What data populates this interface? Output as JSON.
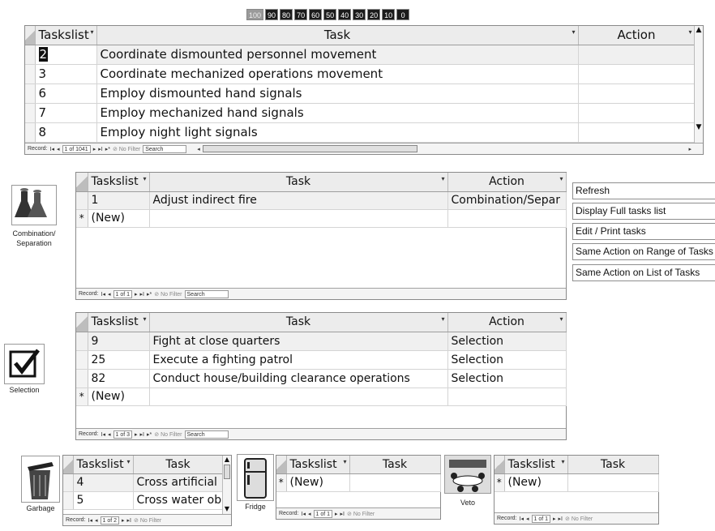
{
  "percent_buttons": [
    "100",
    "90",
    "80",
    "70",
    "60",
    "50",
    "40",
    "30",
    "20",
    "10",
    "0"
  ],
  "active_percent": "100",
  "columns": {
    "tasklist": "Taskslist",
    "task": "Task",
    "action": "Action"
  },
  "main_grid": {
    "rows": [
      {
        "id": "2",
        "task": "Coordinate dismounted personnel movement",
        "action": ""
      },
      {
        "id": "3",
        "task": "Coordinate mechanized operations movement",
        "action": ""
      },
      {
        "id": "6",
        "task": "Employ dismounted hand signals",
        "action": ""
      },
      {
        "id": "7",
        "task": "Employ mechanized hand signals",
        "action": ""
      },
      {
        "id": "8",
        "task": "Employ night light signals",
        "action": ""
      }
    ],
    "record": "Record:",
    "record_pos": "1 of 1041",
    "no_filter": "No Filter",
    "search": "Search"
  },
  "combination": {
    "label": "Combination/ Separation",
    "rows": [
      {
        "id": "1",
        "task": "Adjust indirect fire",
        "action": "Combination/Separ"
      }
    ],
    "new_row": "(New)",
    "record_pos": "1 of 1"
  },
  "selection": {
    "label": "Selection",
    "rows": [
      {
        "id": "9",
        "task": "Fight at close quarters",
        "action": "Selection"
      },
      {
        "id": "25",
        "task": "Execute a fighting patrol",
        "action": "Selection"
      },
      {
        "id": "82",
        "task": "Conduct house/building clearance operations",
        "action": "Selection"
      }
    ],
    "new_row": "(New)",
    "record_pos": "1 of 3"
  },
  "garbage": {
    "label": "Garbage",
    "rows": [
      {
        "id": "4",
        "task": "Cross artificial"
      },
      {
        "id": "5",
        "task": "Cross water ob"
      }
    ],
    "record_pos": "1 of 2"
  },
  "fridge": {
    "label": "Fridge",
    "new_row": "(New)",
    "record_pos": "1 of 1"
  },
  "veto": {
    "label": "Veto",
    "new_row": "(New)",
    "record_pos": "1 of 1"
  },
  "buttons": {
    "refresh": "Refresh",
    "full_list": "Display Full tasks list",
    "edit_print": "Edit / Print tasks",
    "same_range": "Same Action on Range of Tasks",
    "same_list": "Same Action on List of Tasks"
  }
}
